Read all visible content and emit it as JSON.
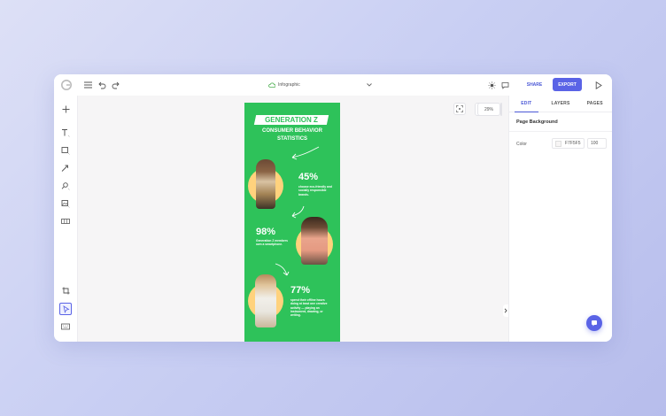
{
  "header": {
    "doc_title": "Infographic",
    "share_label": "SHARE",
    "export_label": "EXPORT"
  },
  "canvas": {
    "zoom": "29%"
  },
  "right_panel": {
    "tabs": [
      {
        "label": "EDIT",
        "active": true
      },
      {
        "label": "LAYERS",
        "active": false
      },
      {
        "label": "PAGES",
        "active": false
      }
    ],
    "section_title": "Page Background",
    "color_label": "Color",
    "color_value": "F7F5F5",
    "opacity_value": "100"
  },
  "infographic": {
    "title": "GENERATION Z",
    "subtitle_line1": "CONSUMER BEHAVIOR",
    "subtitle_line2": "STATISTICS",
    "stat1_value": "45%",
    "stat1_text": "choose eco-friendly and socially responsible brands.",
    "stat2_value": "98%",
    "stat2_text": "Generation Z members own a smartphone.",
    "stat3_value": "77%",
    "stat3_text": "spend their offline hours doing at least one creative activity — playing an instrument, drawing, or writing."
  },
  "colors": {
    "accent": "#5a63e6",
    "infographic_green": "#2ec25a",
    "circle_yellow": "#ffd27d",
    "canvas_bg": "#f6f5f6"
  },
  "icons": [
    "app-logo-icon",
    "menu-icon",
    "undo-icon",
    "redo-icon",
    "cloud-icon",
    "chevron-down-icon",
    "sun-icon",
    "comment-icon",
    "play-icon",
    "add-icon",
    "text-icon",
    "shape-icon",
    "arrow-icon",
    "search-image-icon",
    "image-icon",
    "grid-icon",
    "crop-icon",
    "select-icon",
    "keyboard-icon",
    "pin-icon",
    "focus-icon",
    "minus-icon",
    "plus-icon",
    "chat-icon"
  ]
}
